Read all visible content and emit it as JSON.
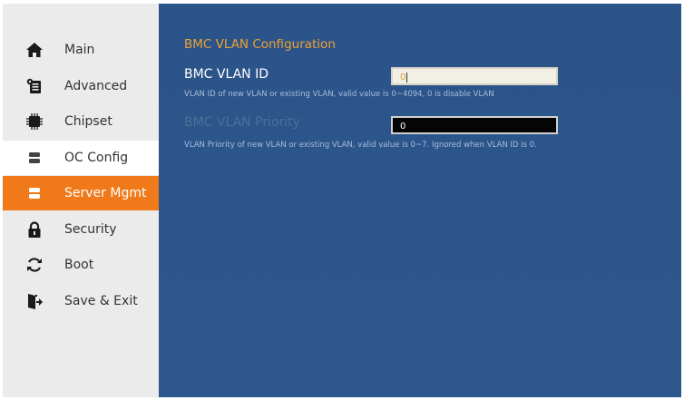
{
  "sidebar": {
    "items": [
      {
        "label": "Main",
        "icon": "home-icon",
        "state": "normal"
      },
      {
        "label": "Advanced",
        "icon": "advanced-icon",
        "state": "normal"
      },
      {
        "label": "Chipset",
        "icon": "chip-icon",
        "state": "normal"
      },
      {
        "label": "OC Config",
        "icon": "oc-config-icon",
        "state": "hover"
      },
      {
        "label": "Server Mgmt",
        "icon": "server-icon",
        "state": "active"
      },
      {
        "label": "Security",
        "icon": "lock-icon",
        "state": "normal"
      },
      {
        "label": "Boot",
        "icon": "refresh-icon",
        "state": "normal"
      },
      {
        "label": "Save & Exit",
        "icon": "exit-icon",
        "state": "normal"
      }
    ]
  },
  "main": {
    "section_title": "BMC VLAN Configuration",
    "vlan_id": {
      "label": "BMC VLAN ID",
      "value": "0",
      "help": "VLAN ID of new VLAN or existing VLAN, valid value is 0~4094, 0 is disable VLAN"
    },
    "vlan_priority": {
      "label": "BMC VLAN Priority",
      "value": "0",
      "help": "VLAN Priority of new VLAN or existing VLAN, valid value is 0~7. Ignored when VLAN ID is 0."
    }
  },
  "colors": {
    "accent": "#f07a1a",
    "panel": "#2c558b",
    "title": "#f0a030"
  }
}
